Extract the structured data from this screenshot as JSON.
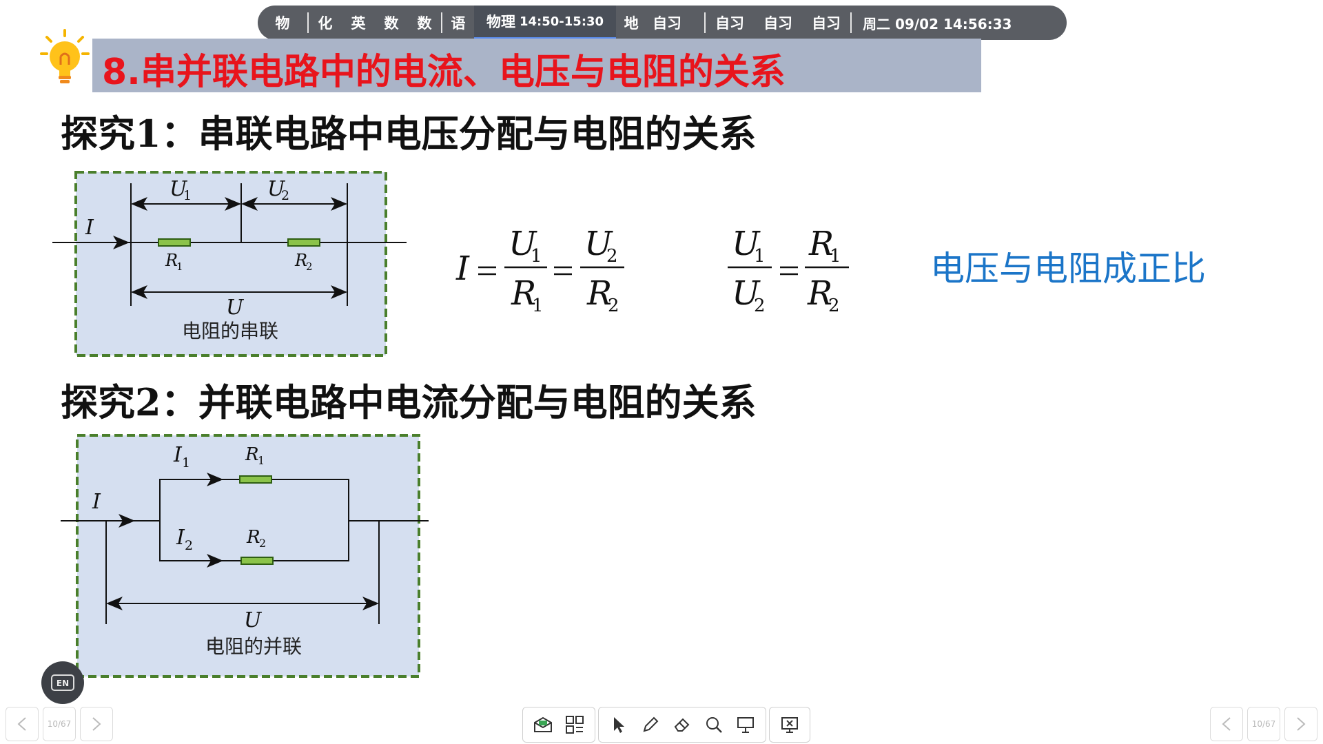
{
  "schedule": {
    "items": [
      "物",
      "化",
      "英",
      "数",
      "数",
      "语"
    ],
    "active": {
      "subject": "物理",
      "time": "14:50-15:30"
    },
    "after": [
      "地",
      "自习",
      "自习",
      "自习",
      "自习"
    ],
    "datetime": "周二 09/02  14:56:33"
  },
  "slide": {
    "title": "8.串并联电路中的电流、电压与电阻的关系",
    "heading1": "探究1：串联电路中电压分配与电阻的关系",
    "heading2": "探究2：并联电路中电流分配与电阻的关系",
    "series_caption": "电阻的串联",
    "parallel_caption": "电阻的并联",
    "ratio_text": "电压与电阻成正比"
  },
  "labels": {
    "I": "I",
    "U": "U",
    "R": "R",
    "one": "1",
    "two": "2"
  },
  "toolbar": {
    "tools": [
      "envelope-icon",
      "apps-icon",
      "pointer-icon",
      "pen-icon",
      "eraser-icon",
      "search-icon",
      "screen-icon",
      "close-screen-icon"
    ]
  },
  "pager": {
    "left": "10/67",
    "right": "10/67"
  },
  "language_badge": "EN"
}
